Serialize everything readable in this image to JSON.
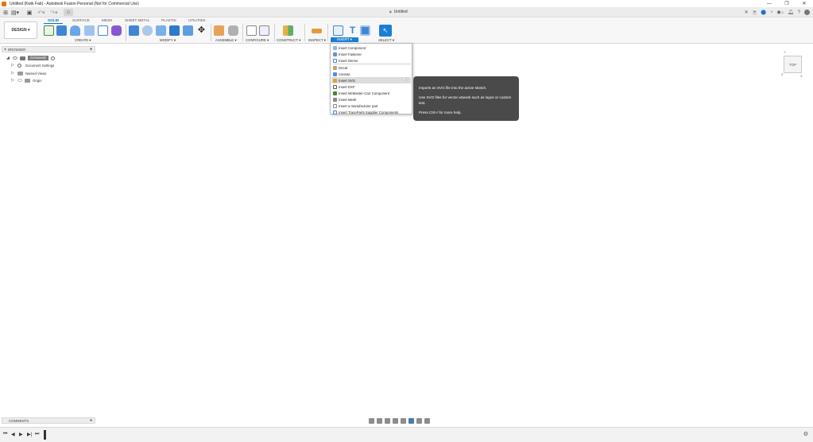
{
  "window": {
    "title": "Untitled (Kwik Fab) - Autodesk Fusion Personal (Not for Commercial Use)",
    "controls": [
      "—",
      "❐",
      "✕"
    ]
  },
  "qat": {
    "doc_tab": "Untitled",
    "right_badges": [
      "1"
    ]
  },
  "toolbar": {
    "workspace": "DESIGN ▾",
    "tabs": [
      "SOLID",
      "SURFACE",
      "MESH",
      "SHEET METAL",
      "PLASTIC",
      "UTILITIES"
    ],
    "active_tab": "SOLID",
    "groups": [
      "CREATE ▾",
      "MODIFY ▾",
      "ASSEMBLE ▾",
      "CONFIGURE ▾",
      "CONSTRUCT ▾",
      "INSPECT ▾",
      "INSERT ▾",
      "SELECT ▾"
    ]
  },
  "browser": {
    "header": "BROWSER",
    "root": "(Unsaved)",
    "items": [
      "Document Settings",
      "Named Views",
      "Origin"
    ]
  },
  "insert_menu": {
    "items": [
      "Insert Component",
      "Insert Fastener",
      "Insert Derive",
      "Decal",
      "Canvas",
      "Insert SVG",
      "Insert DXF",
      "Insert McMaster-Carr Component",
      "Insert Mesh",
      "Insert a manufacturer part",
      "Insert TraceParts Supplier Components"
    ],
    "highlighted": "Insert SVG"
  },
  "tooltip": {
    "line1": "Imports an SVG file into the active sketch.",
    "line2": "Use SVG files for vector artwork such as logos or custom text.",
    "line3": "Press Ctrl+/ for more help."
  },
  "viewcube": {
    "face": "TOP",
    "axes": [
      "Y",
      "X",
      "Z"
    ]
  },
  "comments": {
    "label": "COMMENTS"
  },
  "colors": {
    "accent": "#1a7fd4",
    "tooltip_bg": "#4a4a4a",
    "active_tab": "#0f6ebc"
  }
}
